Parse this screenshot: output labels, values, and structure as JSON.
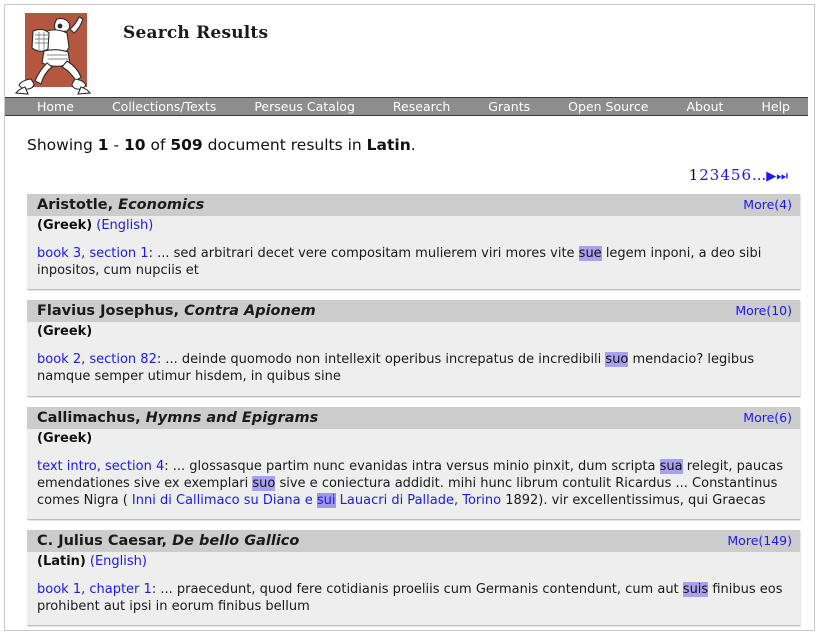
{
  "header": {
    "site_title": "Search Results",
    "logo_alt": "perseus-running-figure-logo",
    "logo_bg_color": "#b5563f"
  },
  "nav": {
    "items": [
      {
        "label": "Home",
        "name": "nav-home"
      },
      {
        "label": "Collections/Texts",
        "name": "nav-collections-texts"
      },
      {
        "label": "Perseus Catalog",
        "name": "nav-perseus-catalog"
      },
      {
        "label": "Research",
        "name": "nav-research"
      },
      {
        "label": "Grants",
        "name": "nav-grants"
      },
      {
        "label": "Open Source",
        "name": "nav-open-source"
      },
      {
        "label": "About",
        "name": "nav-about"
      },
      {
        "label": "Help",
        "name": "nav-help"
      }
    ]
  },
  "summary": {
    "prefix": "Showing ",
    "range_start": "1",
    "dash": " - ",
    "range_end": "10",
    "of": " of ",
    "total": "509",
    "middle": " document results in ",
    "language": "Latin",
    "suffix": "."
  },
  "pagination": {
    "current": "1",
    "pages": [
      "2",
      "3",
      "4",
      "5",
      "6"
    ],
    "ellipsis": "...",
    "next_icon": "▶",
    "last_icon": "⏭"
  },
  "results": [
    {
      "author": "Aristotle, ",
      "work": "Economics",
      "more_label": "More(4)",
      "primary_lang": "(Greek)",
      "alt_lang": "(English)",
      "citation": "book 3, section 1",
      "snippet_pre": ": ... sed arbitrari decet vere compositam mulierem viri mores vite ",
      "highlight": "sue",
      "snippet_post": " legem inponi, a deo sibi inpositos, cum nupciis et"
    },
    {
      "author": "Flavius Josephus, ",
      "work": "Contra Apionem",
      "more_label": "More(10)",
      "primary_lang": "(Greek)",
      "alt_lang": "",
      "citation": "book 2, section 82",
      "snippet_pre": ": ... deinde quomodo non intellexit operibus increpatus de incredibili ",
      "highlight": "suo",
      "snippet_post": " mendacio? legibus namque semper utimur hisdem, in quibus sine"
    },
    {
      "author": "Callimachus, ",
      "work": "Hymns and Epigrams",
      "more_label": "More(6)",
      "primary_lang": "(Greek)",
      "alt_lang": "",
      "citation": "text intro, section 4",
      "snippet_pre": ": ... glossasque partim nunc evanidas intra versus minio pinxit, dum scripta ",
      "highlight": "sua",
      "snippet_mid1": " relegit, paucas emendationes sive ex exemplari ",
      "highlight2": "suo",
      "snippet_mid2": " sive e coniectura addidit. mihi hunc librum contulit Ricardus ... Constantinus comes Nigra ( ",
      "link_pre": "Inni di Callimaco su Diana e ",
      "highlight3": "sui",
      "link_post": " Lauacri di Pallade, Torino",
      "snippet_post": " 1892). vir excellentissimus, qui Graecas"
    },
    {
      "author": "C. Julius Caesar, ",
      "work": "De bello Gallico",
      "more_label": "More(149)",
      "primary_lang": "(Latin)",
      "alt_lang": "(English)",
      "citation": "book 1, chapter 1",
      "snippet_pre": ": ... praecedunt, quod fere cotidianis proeliis cum Germanis contendunt, cum aut ",
      "highlight": "suis",
      "snippet_post": " finibus eos prohibent aut ipsi in eorum finibus bellum"
    }
  ],
  "colors": {
    "nav_bg": "#8d8d8d",
    "card_head_bg": "#cccccc",
    "card_body_bg": "#eeeeee",
    "link_blue": "#1a1aee",
    "highlight_purple": "#a9a0f0"
  }
}
